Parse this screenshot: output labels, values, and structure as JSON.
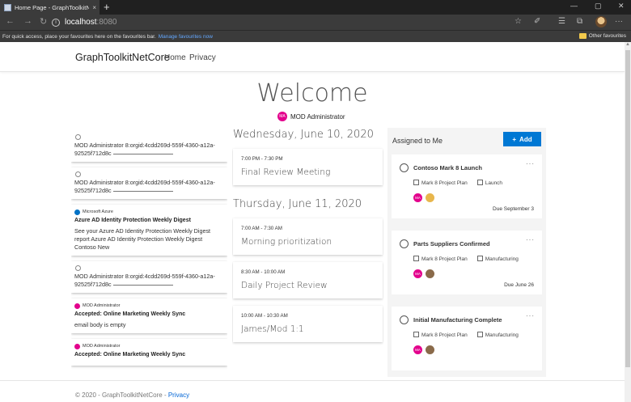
{
  "browser": {
    "tab_title": "Home Page - GraphToolkitNetC",
    "tab_close": "×",
    "new_tab": "+",
    "url_host": "localhost",
    "url_port": ":8080",
    "nav_back": "←",
    "nav_forward": "→",
    "nav_refresh": "↻",
    "info": "i",
    "tools": [
      "☆",
      "✐",
      "☰",
      "⧉",
      "···"
    ],
    "window_controls": [
      "—",
      "▢",
      "✕"
    ],
    "favbar_text": "For quick access, place your favourites here on the favourites bar.",
    "favbar_link": "Manage favourites now",
    "other_favourites": "Other favourites"
  },
  "navbar": {
    "brand": "GraphToolkitNetCore",
    "links": [
      "Home",
      "Privacy"
    ]
  },
  "welcome": "Welcome",
  "user": {
    "initials": "MA",
    "name": "MOD Administrator"
  },
  "mail_cards": [
    {
      "type": "person",
      "text": "MOD Administrator 8:orgid:4cdd269d-559f-4360-a12a-92525f712d8c"
    },
    {
      "type": "person",
      "text": "MOD Administrator 8:orgid:4cdd269d-559f-4360-a12a-92525f712d8c"
    },
    {
      "type": "email",
      "sender": "Microsoft Azure",
      "subject": "Azure AD Identity Protection Weekly Digest",
      "body": "See your Azure AD Identity Protection Weekly Digest report Azure AD Identity Protection Weekly Digest Contoso New"
    },
    {
      "type": "person",
      "text": "MOD Administrator 8:orgid:4cdd269d-559f-4360-a12a-92525f712d8c"
    },
    {
      "type": "email",
      "sender": "MOD Administrator",
      "subject": "Accepted: Online Marketing Weekly Sync",
      "body": "email body is empty"
    },
    {
      "type": "email",
      "sender": "MOD Administrator",
      "subject": "Accepted: Online Marketing Weekly Sync",
      "body": ""
    }
  ],
  "agenda": [
    {
      "day": "Wednesday, June 10, 2020",
      "events": [
        {
          "time": "7:00 PM - 7:30 PM",
          "subject": "Final Review Meeting"
        }
      ]
    },
    {
      "day": "Thursday, June 11, 2020",
      "events": [
        {
          "time": "7:00 AM - 7:30 AM",
          "subject": "Morning prioritization"
        },
        {
          "time": "8:30 AM - 10:00 AM",
          "subject": "Daily Project Review"
        },
        {
          "time": "10:00 AM - 10:30 AM",
          "subject": "James/Mod 1:1"
        }
      ]
    }
  ],
  "tasks": {
    "title": "Assigned to Me",
    "add_label": "Add",
    "add_icon": "+",
    "items": [
      {
        "name": "Contoso Mark 8 Launch",
        "plan": "Mark 8 Project Plan",
        "bucket": "Launch",
        "due": "Due September 3"
      },
      {
        "name": "Parts Suppliers Confirmed",
        "plan": "Mark 8 Project Plan",
        "bucket": "Manufacturing",
        "due": "Due June 26"
      },
      {
        "name": "Initial Manufacturing Complete",
        "plan": "Mark 8 Project Plan",
        "bucket": "Manufacturing",
        "due": ""
      }
    ],
    "more": "···",
    "assignee_initials": "MA"
  },
  "footer": {
    "text": "© 2020 - GraphToolkitNetCore - ",
    "link": "Privacy"
  },
  "colors": {
    "accent": "#0078d4",
    "avatar": "#e3008c",
    "azure": "#0072c6"
  }
}
